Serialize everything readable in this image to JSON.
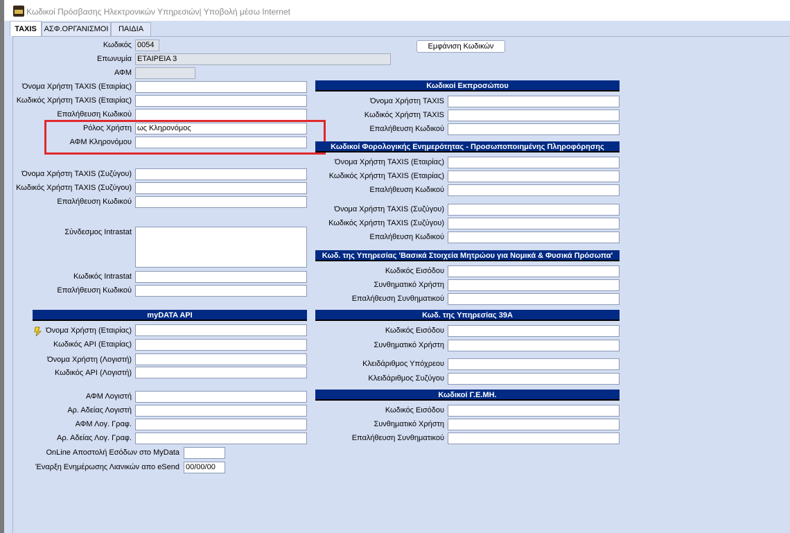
{
  "window": {
    "title": "Κωδικοί Πρόσβασης Ηλεκτρονικών Υπηρεσιών| Υποβολή μέσω Internet"
  },
  "tabs": [
    "TAXIS",
    "ΑΣΦ.ΟΡΓΑΝΙΣΜΟΙ",
    "ΠΑΙΔΙΑ"
  ],
  "show_codes_button": "Εμφάνιση Κωδικών",
  "left": {
    "code_label": "Κωδικός",
    "code_value": "0054",
    "name_label": "Επωνυμία",
    "name_value": "ΕΤΑΙΡΕΙΑ 3",
    "afm_label": "ΑΦΜ",
    "afm_value": "",
    "taxis_user_company": "Όνομα Χρήστη TAXIS (Εταιρίας)",
    "taxis_pass_company": "Κωδικός Χρήστη TAXIS (Εταιρίας)",
    "verify_code_1": "Επαλήθευση Κωδικού",
    "user_role_label": "Ρόλος Χρήστη",
    "user_role_value": "ως Κληρονόμος",
    "heir_afm_label": "ΑΦΜ Κληρονόμου",
    "taxis_user_spouse": "Όνομα Χρήστη TAXIS (Συζύγου)",
    "taxis_pass_spouse": "Κωδικός Χρήστη TAXIS (Συζύγου)",
    "verify_code_2": "Επαλήθευση Κωδικού",
    "intrastat_link": "Σύνδεσμος Intrastat",
    "intrastat_code": "Κωδικός Intrastat",
    "verify_code_3": "Επαλήθευση Κωδικού"
  },
  "mydata": {
    "header": "myDATA API",
    "user_company": "Όνομα Χρήστη (Εταιρίας)",
    "api_company": "Κωδικός API (Εταιρίας)",
    "user_accountant": "Όνομα Χρήστη (Λογιστή)",
    "api_accountant": "Κωδικός API (Λογιστή)",
    "afm_accountant": "ΑΦΜ Λογιστή",
    "license_accountant": "Αρ. Αδείας Λογιστή",
    "afm_office": "ΑΦΜ Λογ. Γραφ.",
    "license_office": "Αρ. Αδείας Λογ. Γραφ.",
    "online_send": "OnLine Αποστολή Εσόδων στο MyData",
    "esend_start": "Έναρξη Ενημέρωσης Λιανικών απο eSend",
    "esend_date": "00/00/00"
  },
  "rep": {
    "header": "Κωδικοί Εκπροσώπου",
    "user": "Όνομα Χρήστη TAXIS",
    "pass": "Κωδικός Χρήστη TAXIS",
    "verify": "Επαλήθευση Κωδικού"
  },
  "tax": {
    "header": "Κωδικοί Φορολογικής Ενημερότητας - Προσωποποιημένης Πληροφόρησης",
    "user_company": "Όνομα Χρήστη TAXIS (Εταιρίας)",
    "pass_company": "Κωδικός Χρήστη TAXIS (Εταιρίας)",
    "verify_1": "Επαλήθευση Κωδικού",
    "user_spouse": "Όνομα Χρήστη TAXIS (Συζύγου)",
    "pass_spouse": "Κωδικός Χρήστη TAXIS (Συζύγου)",
    "verify_2": "Επαλήθευση Κωδικού"
  },
  "registry": {
    "header": "Κωδ. της Υπηρεσίας 'Βασικά Στοιχεία Μητρώου για Νομικά & Φυσικά Πρόσωπα'",
    "login": "Κωδικός Εισόδου",
    "password": "Συνθηματικό Χρήστη",
    "verify": "Επαλήθευση Συνθηματικού"
  },
  "svc39a": {
    "header": "Κωδ. της Υπηρεσίας 39Α",
    "login": "Κωδικός Εισόδου",
    "password": "Συνθηματικό Χρήστη",
    "key_obligor": "Κλειδάριθμος Υπόχρεου",
    "key_spouse": "Κλειδάριθμος Συζύγου"
  },
  "gemi": {
    "header": "Κωδικοί Γ.Ε.ΜΗ.",
    "login": "Κωδικός Εισόδου",
    "password": "Συνθηματικό Χρήστη",
    "verify": "Επαλήθευση Συνθηματικού"
  }
}
